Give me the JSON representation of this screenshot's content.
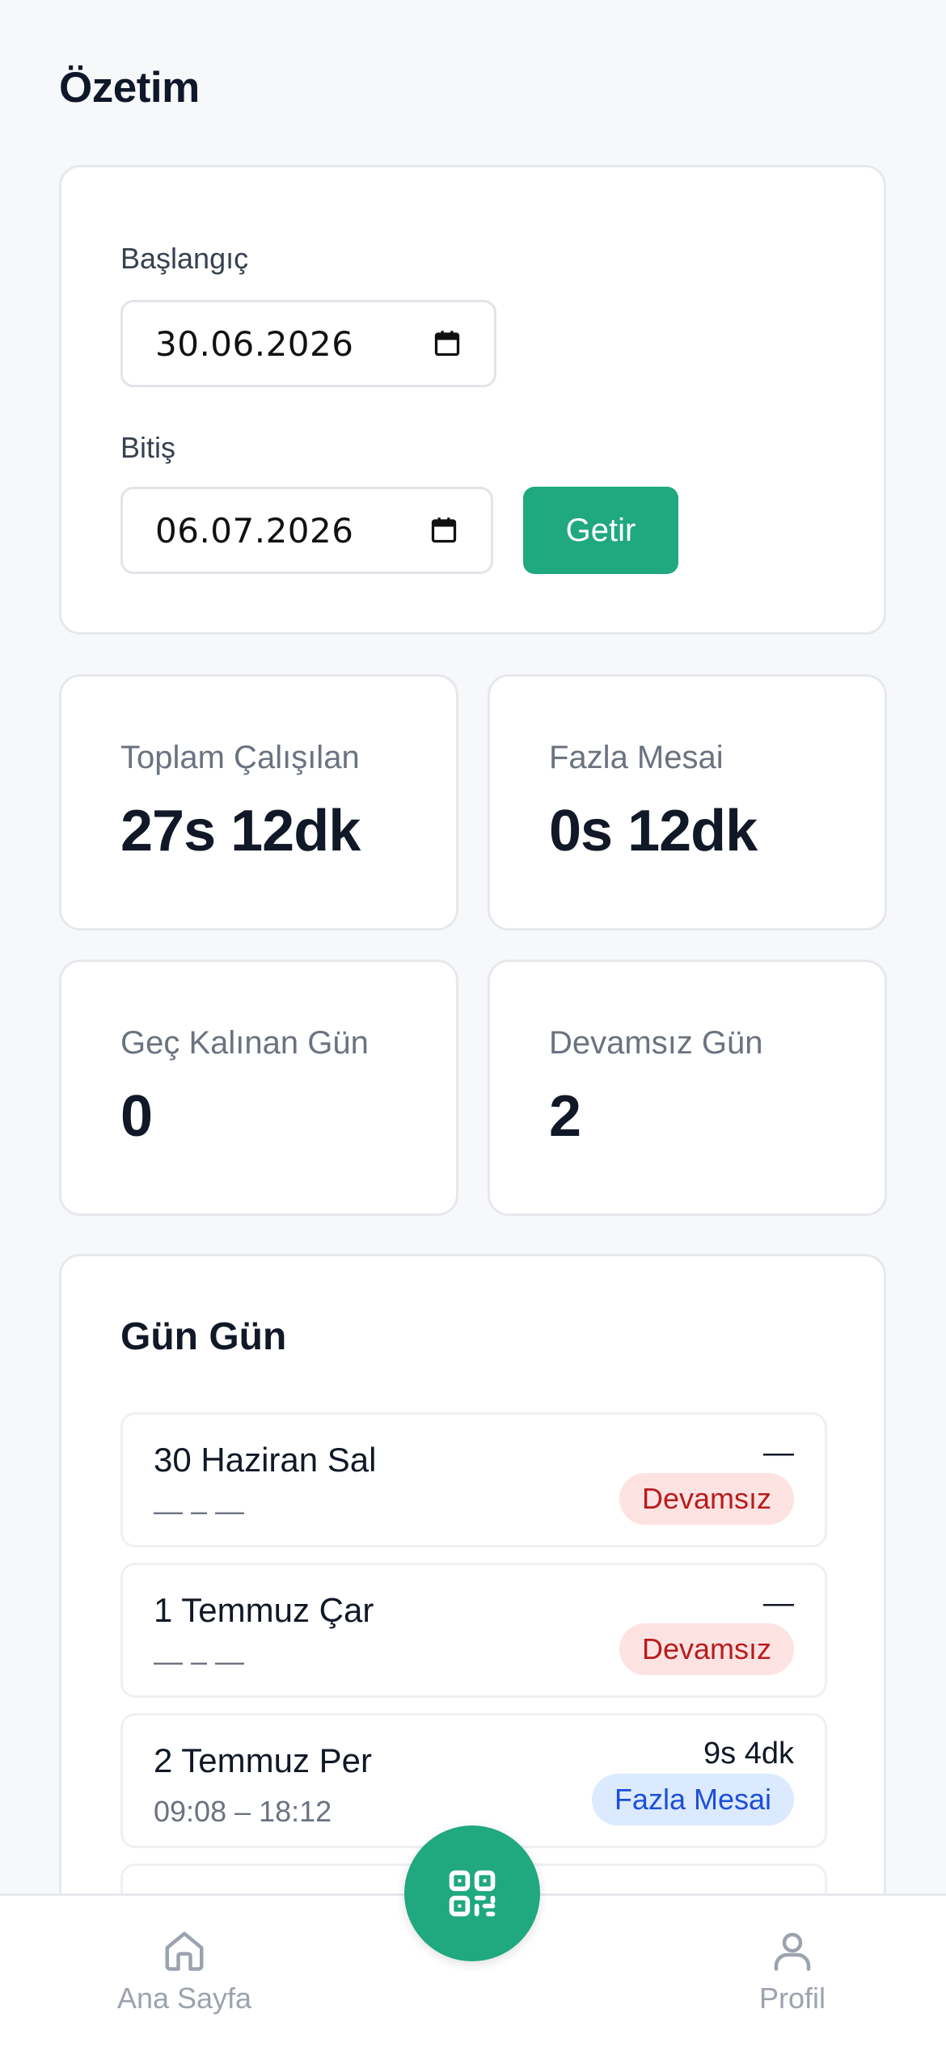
{
  "header": {
    "title": "Özetim"
  },
  "filter": {
    "start_label": "Başlangıç",
    "start_value": "30.06.2026",
    "end_label": "Bitiş",
    "end_value": "06.07.2026",
    "submit_label": "Getir"
  },
  "stats": [
    {
      "label": "Toplam Çalışılan",
      "value": "27s 12dk"
    },
    {
      "label": "Fazla Mesai",
      "value": "0s 12dk"
    },
    {
      "label": "Geç Kalınan Gün",
      "value": "0"
    },
    {
      "label": "Devamsız Gün",
      "value": "2"
    }
  ],
  "days": {
    "title": "Gün Gün",
    "items": [
      {
        "date": "30 Haziran Sal",
        "times": "— – —",
        "duration": "—",
        "badge": "Devamsız",
        "badge_color": "#b91c1c"
      },
      {
        "date": "1 Temmuz Çar",
        "times": "— – —",
        "duration": "—",
        "badge": "Devamsız",
        "badge_color": "#b91c1c"
      },
      {
        "date": "2 Temmuz Per",
        "times": "09:08 – 18:12",
        "duration": "9s 4dk",
        "badge": "Fazla Mesai",
        "badge_color": "#1d4ed8"
      }
    ]
  },
  "nav": {
    "home_label": "Ana Sayfa",
    "home_icon": "home-icon",
    "scan_icon": "qr-code-icon",
    "profile_label": "Profil",
    "profile_icon": "user-icon"
  },
  "colors": {
    "accent": "#20a87e",
    "background": "#f7f8fa"
  }
}
